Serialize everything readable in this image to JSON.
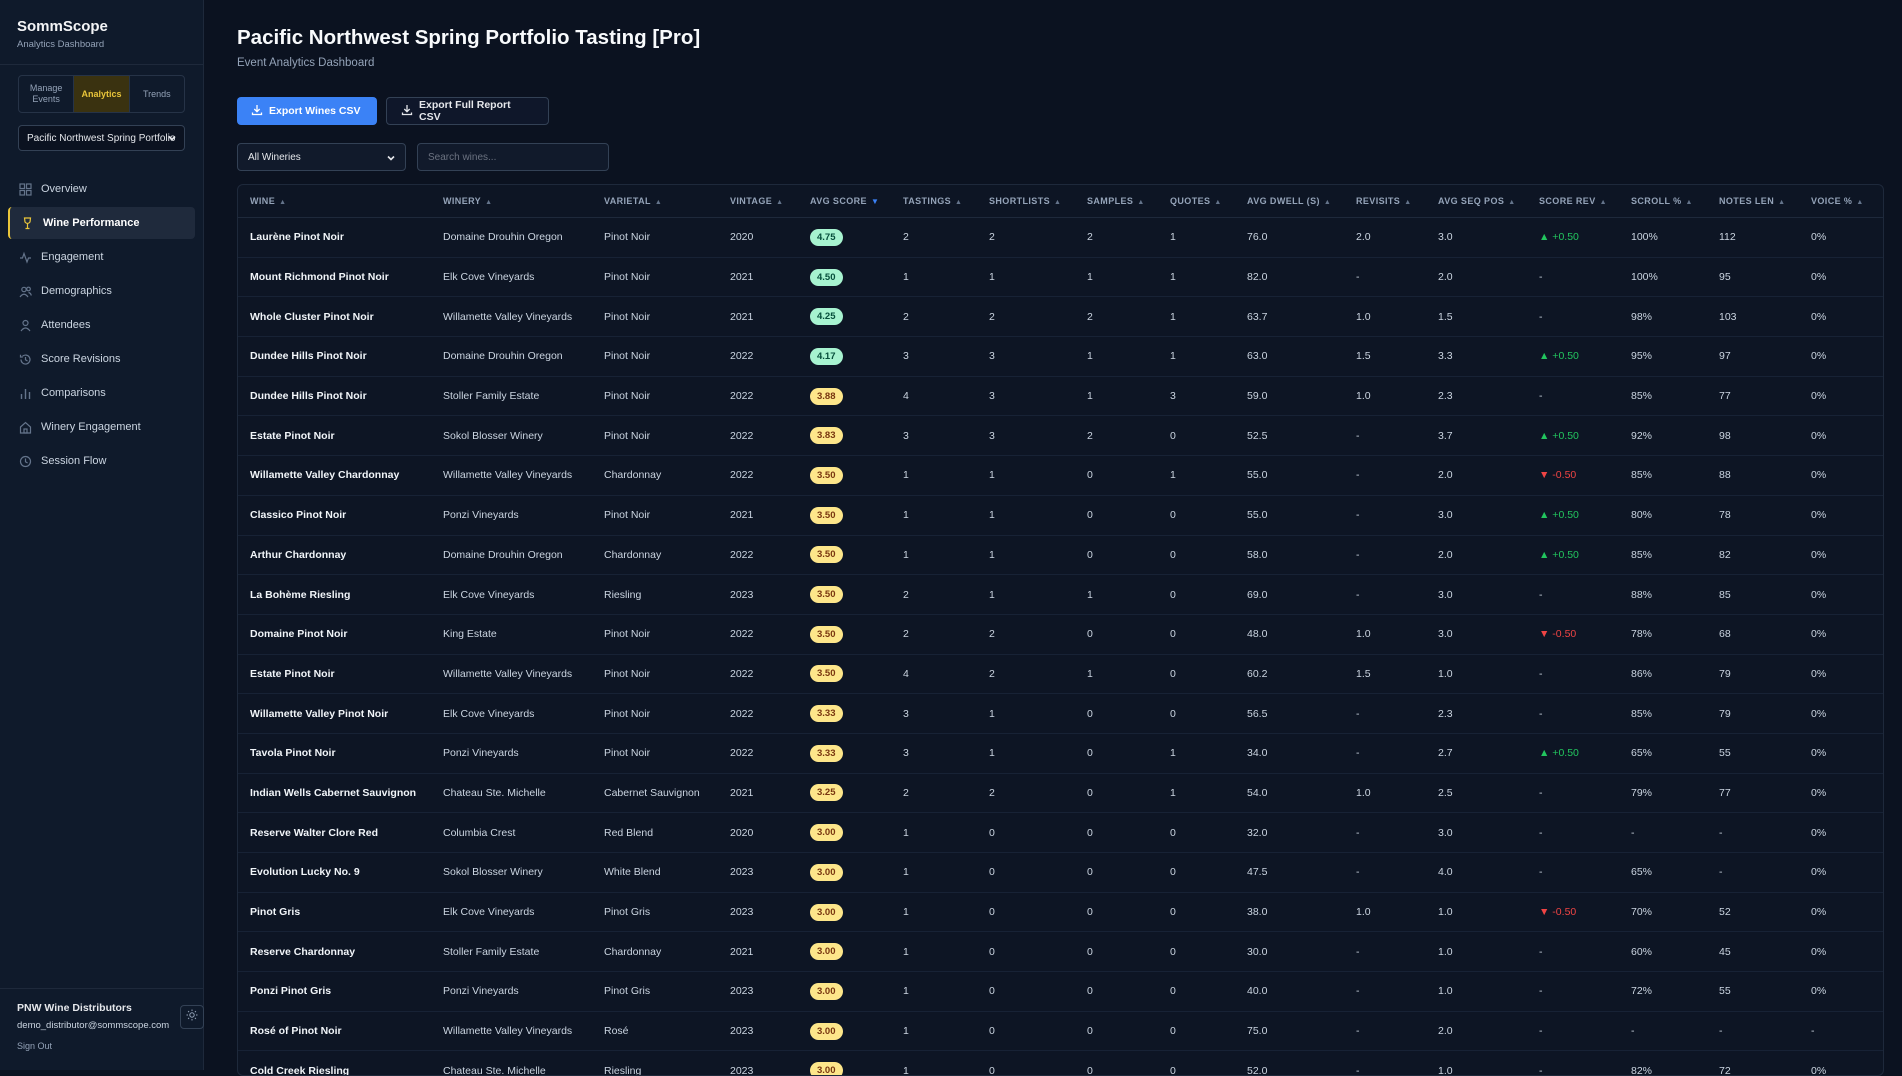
{
  "app": {
    "name": "SommScope",
    "subtitle": "Analytics Dashboard"
  },
  "segments": [
    {
      "label": "Manage Events",
      "active": false
    },
    {
      "label": "Analytics",
      "active": true
    },
    {
      "label": "Trends",
      "active": false
    }
  ],
  "event_select": {
    "value": "Pacific Northwest Spring Portfolio Tasting [Pro]"
  },
  "nav": [
    {
      "label": "Overview",
      "icon": "grid-icon",
      "active": false
    },
    {
      "label": "Wine Performance",
      "icon": "wine-glass-icon",
      "active": true
    },
    {
      "label": "Engagement",
      "icon": "activity-icon",
      "active": false
    },
    {
      "label": "Demographics",
      "icon": "users-icon",
      "active": false
    },
    {
      "label": "Attendees",
      "icon": "user-icon",
      "active": false
    },
    {
      "label": "Score Revisions",
      "icon": "history-icon",
      "active": false
    },
    {
      "label": "Comparisons",
      "icon": "bar-chart-icon",
      "active": false
    },
    {
      "label": "Winery Engagement",
      "icon": "building-icon",
      "active": false
    },
    {
      "label": "Session Flow",
      "icon": "clock-icon",
      "active": false
    }
  ],
  "user": {
    "org": "PNW Wine Distributors",
    "email": "demo_distributor@sommscope.com",
    "signout": "Sign Out"
  },
  "header": {
    "title": "Pacific Northwest Spring Portfolio Tasting [Pro]",
    "subtitle": "Event Analytics Dashboard"
  },
  "actions": {
    "export_wines": "Export Wines CSV",
    "export_report": "Export Full Report CSV"
  },
  "filters": {
    "winery": "All Wineries",
    "search_placeholder": "Search wines..."
  },
  "colors": {
    "accent": "#3b82f6",
    "gold": "#e9c53a",
    "score_high": "#a7f3d0",
    "score_mid": "#fde68a",
    "up": "#22c55e",
    "down": "#ef4444"
  },
  "table": {
    "columns": [
      "WINE",
      "WINERY",
      "VARIETAL",
      "VINTAGE",
      "AVG SCORE",
      "TASTINGS",
      "SHORTLISTS",
      "SAMPLES",
      "QUOTES",
      "AVG DWELL (S)",
      "REVISITS",
      "AVG SEQ POS",
      "SCORE REV",
      "SCROLL %",
      "NOTES LEN",
      "VOICE %"
    ],
    "sorted_column": "AVG SCORE",
    "rows": [
      [
        "Laurène Pinot Noir",
        "Domaine Drouhin Oregon",
        "Pinot Noir",
        "2020",
        "4.75",
        "2",
        "2",
        "2",
        "1",
        "76.0",
        "2.0",
        "3.0",
        "▲ +0.50",
        "100%",
        "112",
        "0%"
      ],
      [
        "Mount Richmond Pinot Noir",
        "Elk Cove Vineyards",
        "Pinot Noir",
        "2021",
        "4.50",
        "1",
        "1",
        "1",
        "1",
        "82.0",
        "-",
        "2.0",
        "-",
        "100%",
        "95",
        "0%"
      ],
      [
        "Whole Cluster Pinot Noir",
        "Willamette Valley Vineyards",
        "Pinot Noir",
        "2021",
        "4.25",
        "2",
        "2",
        "2",
        "1",
        "63.7",
        "1.0",
        "1.5",
        "-",
        "98%",
        "103",
        "0%"
      ],
      [
        "Dundee Hills Pinot Noir",
        "Domaine Drouhin Oregon",
        "Pinot Noir",
        "2022",
        "4.17",
        "3",
        "3",
        "1",
        "1",
        "63.0",
        "1.5",
        "3.3",
        "▲ +0.50",
        "95%",
        "97",
        "0%"
      ],
      [
        "Dundee Hills Pinot Noir",
        "Stoller Family Estate",
        "Pinot Noir",
        "2022",
        "3.88",
        "4",
        "3",
        "1",
        "3",
        "59.0",
        "1.0",
        "2.3",
        "-",
        "85%",
        "77",
        "0%"
      ],
      [
        "Estate Pinot Noir",
        "Sokol Blosser Winery",
        "Pinot Noir",
        "2022",
        "3.83",
        "3",
        "3",
        "2",
        "0",
        "52.5",
        "-",
        "3.7",
        "▲ +0.50",
        "92%",
        "98",
        "0%"
      ],
      [
        "Willamette Valley Chardonnay",
        "Willamette Valley Vineyards",
        "Chardonnay",
        "2022",
        "3.50",
        "1",
        "1",
        "0",
        "1",
        "55.0",
        "-",
        "2.0",
        "▼ -0.50",
        "85%",
        "88",
        "0%"
      ],
      [
        "Classico Pinot Noir",
        "Ponzi Vineyards",
        "Pinot Noir",
        "2021",
        "3.50",
        "1",
        "1",
        "0",
        "0",
        "55.0",
        "-",
        "3.0",
        "▲ +0.50",
        "80%",
        "78",
        "0%"
      ],
      [
        "Arthur Chardonnay",
        "Domaine Drouhin Oregon",
        "Chardonnay",
        "2022",
        "3.50",
        "1",
        "1",
        "0",
        "0",
        "58.0",
        "-",
        "2.0",
        "▲ +0.50",
        "85%",
        "82",
        "0%"
      ],
      [
        "La Bohème Riesling",
        "Elk Cove Vineyards",
        "Riesling",
        "2023",
        "3.50",
        "2",
        "1",
        "1",
        "0",
        "69.0",
        "-",
        "3.0",
        "-",
        "88%",
        "85",
        "0%"
      ],
      [
        "Domaine Pinot Noir",
        "King Estate",
        "Pinot Noir",
        "2022",
        "3.50",
        "2",
        "2",
        "0",
        "0",
        "48.0",
        "1.0",
        "3.0",
        "▼ -0.50",
        "78%",
        "68",
        "0%"
      ],
      [
        "Estate Pinot Noir",
        "Willamette Valley Vineyards",
        "Pinot Noir",
        "2022",
        "3.50",
        "4",
        "2",
        "1",
        "0",
        "60.2",
        "1.5",
        "1.0",
        "-",
        "86%",
        "79",
        "0%"
      ],
      [
        "Willamette Valley Pinot Noir",
        "Elk Cove Vineyards",
        "Pinot Noir",
        "2022",
        "3.33",
        "3",
        "1",
        "0",
        "0",
        "56.5",
        "-",
        "2.3",
        "-",
        "85%",
        "79",
        "0%"
      ],
      [
        "Tavola Pinot Noir",
        "Ponzi Vineyards",
        "Pinot Noir",
        "2022",
        "3.33",
        "3",
        "1",
        "0",
        "1",
        "34.0",
        "-",
        "2.7",
        "▲ +0.50",
        "65%",
        "55",
        "0%"
      ],
      [
        "Indian Wells Cabernet Sauvignon",
        "Chateau Ste. Michelle",
        "Cabernet Sauvignon",
        "2021",
        "3.25",
        "2",
        "2",
        "0",
        "1",
        "54.0",
        "1.0",
        "2.5",
        "-",
        "79%",
        "77",
        "0%"
      ],
      [
        "Reserve Walter Clore Red",
        "Columbia Crest",
        "Red Blend",
        "2020",
        "3.00",
        "1",
        "0",
        "0",
        "0",
        "32.0",
        "-",
        "3.0",
        "-",
        "-",
        "-",
        "0%"
      ],
      [
        "Evolution Lucky No. 9",
        "Sokol Blosser Winery",
        "White Blend",
        "2023",
        "3.00",
        "1",
        "0",
        "0",
        "0",
        "47.5",
        "-",
        "4.0",
        "-",
        "65%",
        "-",
        "0%"
      ],
      [
        "Pinot Gris",
        "Elk Cove Vineyards",
        "Pinot Gris",
        "2023",
        "3.00",
        "1",
        "0",
        "0",
        "0",
        "38.0",
        "1.0",
        "1.0",
        "▼ -0.50",
        "70%",
        "52",
        "0%"
      ],
      [
        "Reserve Chardonnay",
        "Stoller Family Estate",
        "Chardonnay",
        "2021",
        "3.00",
        "1",
        "0",
        "0",
        "0",
        "30.0",
        "-",
        "1.0",
        "-",
        "60%",
        "45",
        "0%"
      ],
      [
        "Ponzi Pinot Gris",
        "Ponzi Vineyards",
        "Pinot Gris",
        "2023",
        "3.00",
        "1",
        "0",
        "0",
        "0",
        "40.0",
        "-",
        "1.0",
        "-",
        "72%",
        "55",
        "0%"
      ],
      [
        "Rosé of Pinot Noir",
        "Willamette Valley Vineyards",
        "Rosé",
        "2023",
        "3.00",
        "1",
        "0",
        "0",
        "0",
        "75.0",
        "-",
        "2.0",
        "-",
        "-",
        "-",
        "-"
      ],
      [
        "Cold Creek Riesling",
        "Chateau Ste. Michelle",
        "Riesling",
        "2023",
        "3.00",
        "1",
        "0",
        "0",
        "0",
        "52.0",
        "-",
        "1.0",
        "-",
        "82%",
        "72",
        "0%"
      ]
    ]
  }
}
